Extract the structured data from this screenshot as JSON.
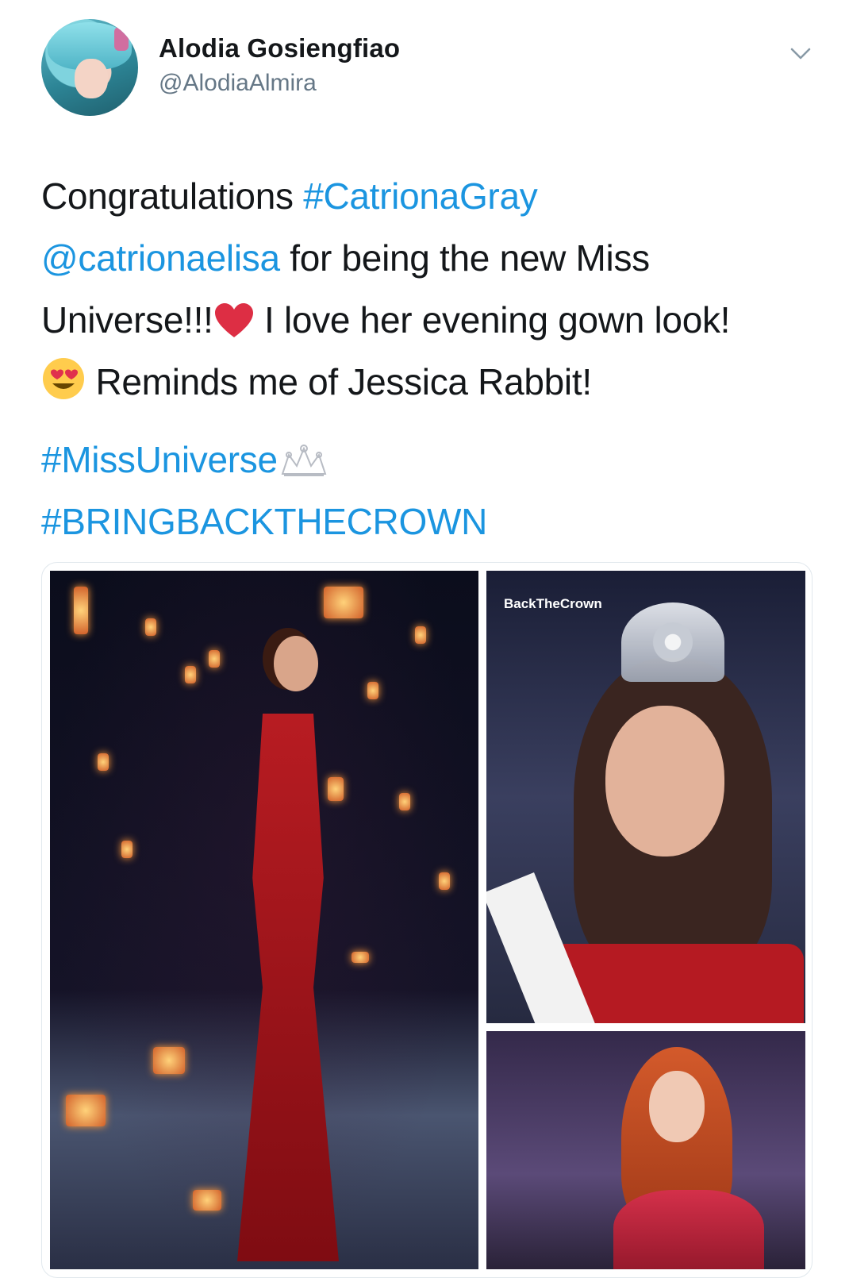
{
  "author": {
    "name": "Alodia Gosiengfiao",
    "handle": "@AlodiaAlmira"
  },
  "icons": {
    "avatar": "profile-photo",
    "menu": "chevron-down-icon",
    "heart": "red-heart-emoji",
    "smile": "heart-eyes-emoji",
    "crown": "crown-emoji"
  },
  "tweet": {
    "line1_text": "Congratulations ",
    "line1_tag": "#CatrionaGray",
    "line2_mention": "@catrionaelisa",
    "line2_text": " for being the new Miss",
    "line3_text_a": "Universe!!!",
    "line3_text_b": " I love her evening gown look!",
    "line4_text": " Reminds me of Jessica Rabbit!",
    "tag_missuniverse": "#MissUniverse",
    "tag_bringback": "#BRINGBACKTHECROWN"
  },
  "media": {
    "watermark": "BackTheCrown"
  },
  "colors": {
    "link": "#1b95e0",
    "text": "#14171a",
    "secondary": "#657786"
  }
}
